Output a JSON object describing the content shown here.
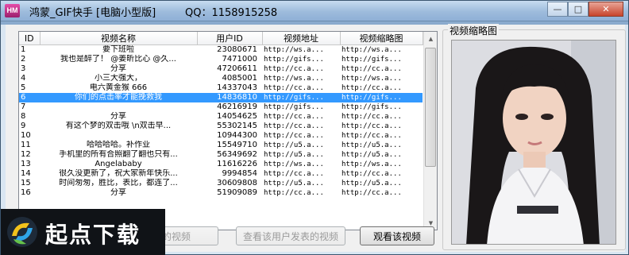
{
  "window": {
    "app_icon_label": "HM",
    "title": "鸿蒙_GIF快手 [电脑小型版]",
    "qq": "QQ：1158915258",
    "minimize_glyph": "—",
    "maximize_glyph": "□",
    "close_glyph": "✕"
  },
  "table": {
    "columns": [
      "ID",
      "视频名称",
      "用户ID",
      "视频地址",
      "视频缩略图"
    ],
    "selected_row_index": 5,
    "rows": [
      [
        "1",
        "要下班啦",
        "23080671",
        "http://ws.a...",
        "http://ws.a..."
      ],
      [
        "2",
        "我也是醉了！ @姜昕比心  @久...",
        "7471000",
        "http://gifs...",
        "http://gifs..."
      ],
      [
        "3",
        "分享",
        "47206611",
        "http://cc.a...",
        "http://cc.a..."
      ],
      [
        "4",
        "小三大强大，",
        "4085001",
        "http://ws.a...",
        "http://ws.a..."
      ],
      [
        "5",
        "电六黄金猴     666",
        "14337043",
        "http://cc.a...",
        "http://cc.a..."
      ],
      [
        "6",
        "你们的点击率才能挽救我",
        "14836810",
        "http://gifs...",
        "http://gifs..."
      ],
      [
        "7",
        "",
        "46216919",
        "http://gifs...",
        "http://gifs..."
      ],
      [
        "8",
        "分享",
        "14054625",
        "http://cc.a...",
        "http://cc.a..."
      ],
      [
        "9",
        "有这个梦的双击哦     \\n双击早...",
        "55302145",
        "http://cc.a...",
        "http://cc.a..."
      ],
      [
        "10",
        "",
        "10944300",
        "http://cc.a...",
        "http://cc.a..."
      ],
      [
        "11",
        "哈哈哈哈。补作业",
        "15549710",
        "http://u5.a...",
        "http://u5.a..."
      ],
      [
        "12",
        "手机里的所有合照翻了翻也只有...",
        "56349692",
        "http://u5.a...",
        "http://u5.a..."
      ],
      [
        "13",
        "Angelababy",
        "11616226",
        "http://ws.a...",
        "http://ws.a..."
      ],
      [
        "14",
        "很久没更新了，祝大家新年快乐...",
        "9994854",
        "http://cc.a...",
        "http://cc.a..."
      ],
      [
        "15",
        "时间匆匆，胜比，表比，都连了...",
        "30609808",
        "http://u5.a...",
        "http://u5.a..."
      ],
      [
        "16",
        "分享",
        "51909089",
        "http://cc.a...",
        "http://cc.a..."
      ]
    ]
  },
  "scrollbar": {
    "up_glyph": "▲",
    "down_glyph": "▼"
  },
  "buttons": {
    "btn1": "成的视频",
    "btn2": "查看该用户发表的视频",
    "btn3": "观看该视频"
  },
  "thumbnail_panel": {
    "legend": "视频缩略图"
  },
  "watermark": {
    "text": "起点下载"
  },
  "colors": {
    "selection": "#3399ff",
    "titlebar": "#9dbbdc"
  }
}
